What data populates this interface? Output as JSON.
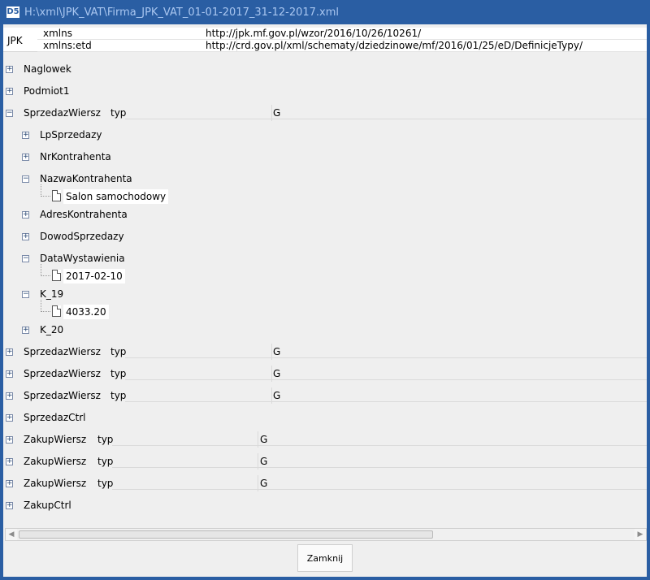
{
  "window": {
    "title": "H:\\xml\\JPK_VAT\\Firma_JPK_VAT_01-01-2017_31-12-2017.xml",
    "icon_text": "D5"
  },
  "header": {
    "root_label": "JPK",
    "namespaces": [
      {
        "key": "xmlns",
        "value": "http://jpk.mf.gov.pl/wzor/2016/10/26/10261/"
      },
      {
        "key": "xmlns:etd",
        "value": "http://crd.gov.pl/xml/schematy/dziedzinowe/mf/2016/01/25/eD/DefinicjeTypy/"
      }
    ]
  },
  "tree": {
    "naglowek": "Naglowek",
    "podmiot": "Podmiot1",
    "sprzedaz_expanded": {
      "label": "SprzedazWiersz",
      "attr_key": "typ",
      "attr_value": "G"
    },
    "children": {
      "lp": "LpSprzedazy",
      "nr": "NrKontrahenta",
      "nazwa": "NazwaKontrahenta",
      "nazwa_value": "Salon samochodowy",
      "adres": "AdresKontrahenta",
      "dowod": "DowodSprzedazy",
      "data": "DataWystawienia",
      "data_value": "2017-02-10",
      "k19": "K_19",
      "k19_value": "4033.20",
      "k20": "K_20"
    },
    "sprzedaz_rows": [
      {
        "label": "SprzedazWiersz",
        "attr_key": "typ",
        "attr_value": "G"
      },
      {
        "label": "SprzedazWiersz",
        "attr_key": "typ",
        "attr_value": "G"
      },
      {
        "label": "SprzedazWiersz",
        "attr_key": "typ",
        "attr_value": "G"
      }
    ],
    "sprzedaz_ctrl": "SprzedazCtrl",
    "zakup_rows": [
      {
        "label": "ZakupWiersz",
        "attr_key": "typ",
        "attr_value": "G"
      },
      {
        "label": "ZakupWiersz",
        "attr_key": "typ",
        "attr_value": "G"
      },
      {
        "label": "ZakupWiersz",
        "attr_key": "typ",
        "attr_value": "G"
      }
    ],
    "zakup_ctrl": "ZakupCtrl"
  },
  "buttons": {
    "close": "Zamknij"
  },
  "colors": {
    "titlebar": "#2a5ea3",
    "title_text": "#a9c6f0",
    "client": "#efefef"
  }
}
